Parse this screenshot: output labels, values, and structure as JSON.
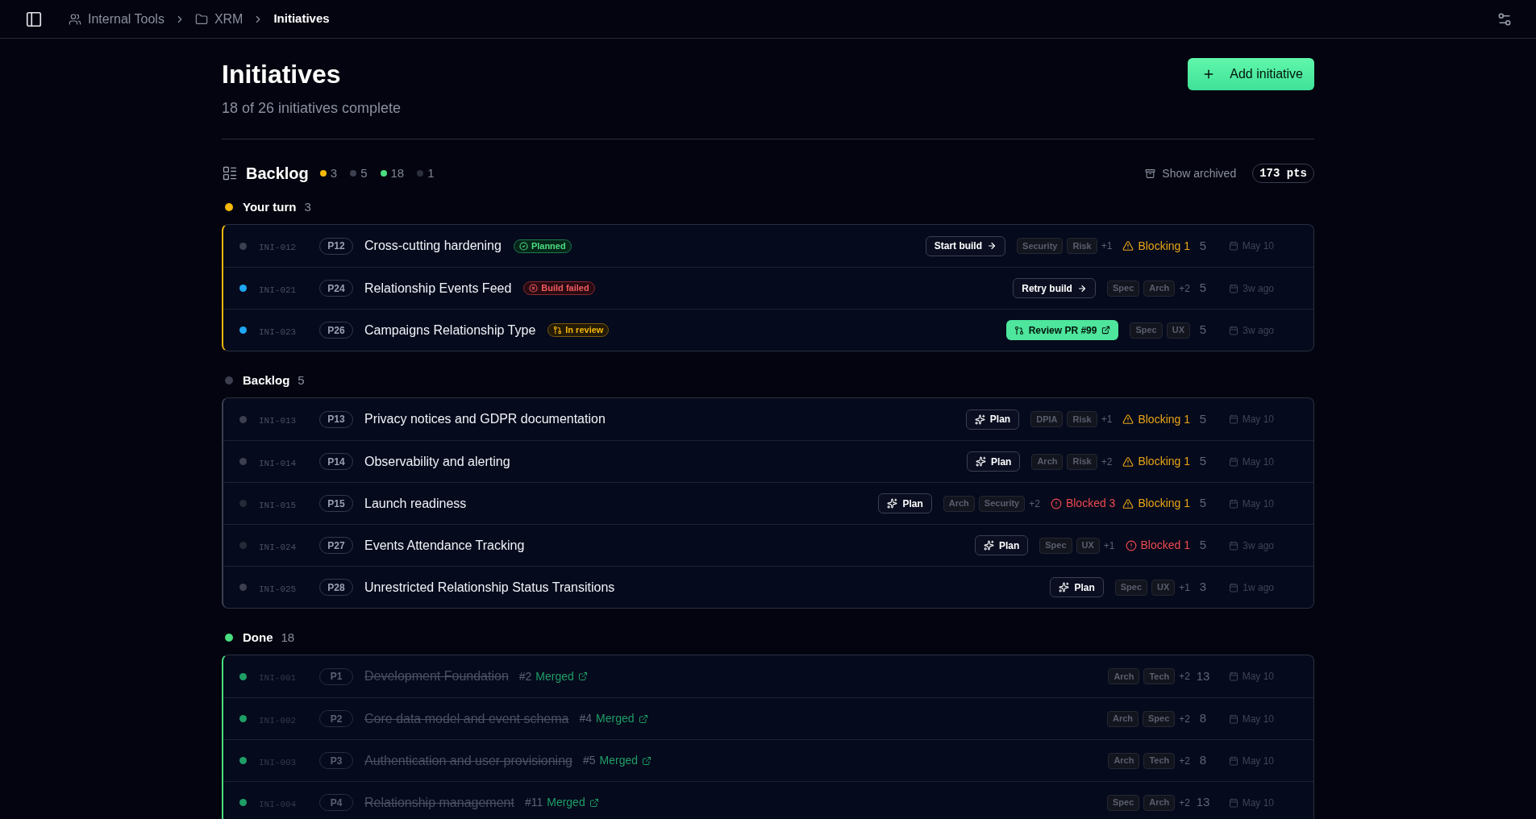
{
  "topbar": {
    "breadcrumbs": [
      {
        "kind": "team",
        "label": "Internal Tools",
        "current": false
      },
      {
        "kind": "folder",
        "label": "XRM",
        "current": false
      },
      {
        "kind": "page",
        "label": "Initiatives",
        "current": true
      }
    ]
  },
  "header": {
    "title": "Initiatives",
    "subtitle": "18 of 26 initiatives complete",
    "add_button": "Add initiative"
  },
  "board": {
    "title": "Backlog",
    "summary": [
      {
        "color": "#f5b80b",
        "count": "3"
      },
      {
        "color": "#3b3f4f",
        "count": "5"
      },
      {
        "color": "#4ade80",
        "count": "18"
      },
      {
        "color": "#2b2f3c",
        "count": "1"
      }
    ],
    "show_archived": "Show archived",
    "total_points": "173 pts"
  },
  "groups": [
    {
      "title": "Your turn",
      "count": "3",
      "color": "#f5b80b",
      "rows": [
        {
          "color": "#3b3f4f",
          "id": "INI-012",
          "priority": "P12",
          "title": "Cross-cutting hardening",
          "done": false,
          "badge": {
            "kind": "planned",
            "label": "Planned"
          },
          "action": {
            "kind": "build",
            "label": "Start build"
          },
          "tags": [
            "Security",
            "Risk"
          ],
          "more_tags": "+1",
          "alerts": [
            {
              "kind": "blocking",
              "label": "Blocking 1"
            }
          ],
          "points": "5",
          "date": "May 10"
        },
        {
          "color": "#1ea7f2",
          "id": "INI-021",
          "priority": "P24",
          "title": "Relationship Events Feed",
          "done": false,
          "badge": {
            "kind": "failed",
            "label": "Build failed"
          },
          "action": {
            "kind": "build",
            "label": "Retry build"
          },
          "tags": [
            "Spec",
            "Arch"
          ],
          "more_tags": "+2",
          "points": "5",
          "date": "3w ago"
        },
        {
          "color": "#1ea7f2",
          "id": "INI-023",
          "priority": "P26",
          "title": "Campaigns Relationship Type",
          "done": false,
          "badge": {
            "kind": "review",
            "label": "In review"
          },
          "action": {
            "kind": "review",
            "label": "Review PR #99"
          },
          "tags": [
            "Spec",
            "UX"
          ],
          "points": "5",
          "date": "3w ago"
        }
      ]
    },
    {
      "title": "Backlog",
      "count": "5",
      "color": "#3b3f4f",
      "rows": [
        {
          "color": "#3b3f4f",
          "id": "INI-013",
          "priority": "P13",
          "title": "Privacy notices and GDPR documentation",
          "done": false,
          "action": {
            "kind": "plan",
            "label": "Plan"
          },
          "tags": [
            "DPIA",
            "Risk"
          ],
          "more_tags": "+1",
          "alerts": [
            {
              "kind": "blocking",
              "label": "Blocking 1"
            }
          ],
          "points": "5",
          "date": "May 10"
        },
        {
          "color": "#3b3f4f",
          "id": "INI-014",
          "priority": "P14",
          "title": "Observability and alerting",
          "done": false,
          "action": {
            "kind": "plan",
            "label": "Plan"
          },
          "tags": [
            "Arch",
            "Risk"
          ],
          "more_tags": "+2",
          "alerts": [
            {
              "kind": "blocking",
              "label": "Blocking 1"
            }
          ],
          "points": "5",
          "date": "May 10"
        },
        {
          "color": "#262a36",
          "id": "INI-015",
          "priority": "P15",
          "title": "Launch readiness",
          "done": false,
          "action": {
            "kind": "plan",
            "label": "Plan"
          },
          "tags": [
            "Arch",
            "Security"
          ],
          "more_tags": "+2",
          "alerts": [
            {
              "kind": "blocked",
              "label": "Blocked 3"
            },
            {
              "kind": "blocking",
              "label": "Blocking 1"
            }
          ],
          "points": "5",
          "date": "May 10"
        },
        {
          "color": "#262a36",
          "id": "INI-024",
          "priority": "P27",
          "title": "Events Attendance Tracking",
          "done": false,
          "action": {
            "kind": "plan",
            "label": "Plan"
          },
          "tags": [
            "Spec",
            "UX"
          ],
          "more_tags": "+1",
          "alerts": [
            {
              "kind": "blocked",
              "label": "Blocked 1"
            }
          ],
          "points": "5",
          "date": "3w ago"
        },
        {
          "color": "#3b3f4f",
          "id": "INI-025",
          "priority": "P28",
          "title": "Unrestricted Relationship Status Transitions",
          "done": false,
          "action": {
            "kind": "plan",
            "label": "Plan"
          },
          "tags": [
            "Spec",
            "UX"
          ],
          "more_tags": "+1",
          "points": "3",
          "date": "1w ago"
        }
      ]
    },
    {
      "title": "Done",
      "count": "18",
      "color": "#4ade80",
      "rows": [
        {
          "color": "#1f9e66",
          "id": "INI-001",
          "priority": "P1",
          "title": "Development Foundation",
          "done": true,
          "pr": {
            "number": "#2",
            "label": "Merged"
          },
          "tags": [
            "Arch",
            "Tech"
          ],
          "more_tags": "+2",
          "points": "13",
          "date": "May 10"
        },
        {
          "color": "#1f9e66",
          "id": "INI-002",
          "priority": "P2",
          "title": "Core data model and event schema",
          "done": true,
          "pr": {
            "number": "#4",
            "label": "Merged"
          },
          "tags": [
            "Arch",
            "Spec"
          ],
          "more_tags": "+2",
          "points": "8",
          "date": "May 10"
        },
        {
          "color": "#1f9e66",
          "id": "INI-003",
          "priority": "P3",
          "title": "Authentication and user provisioning",
          "done": true,
          "pr": {
            "number": "#5",
            "label": "Merged"
          },
          "tags": [
            "Arch",
            "Tech"
          ],
          "more_tags": "+2",
          "points": "8",
          "date": "May 10"
        },
        {
          "color": "#1f9e66",
          "id": "INI-004",
          "priority": "P4",
          "title": "Relationship management",
          "done": true,
          "pr": {
            "number": "#11",
            "label": "Merged"
          },
          "tags": [
            "Spec",
            "Arch"
          ],
          "more_tags": "+2",
          "points": "13",
          "date": "May 10"
        }
      ]
    }
  ]
}
